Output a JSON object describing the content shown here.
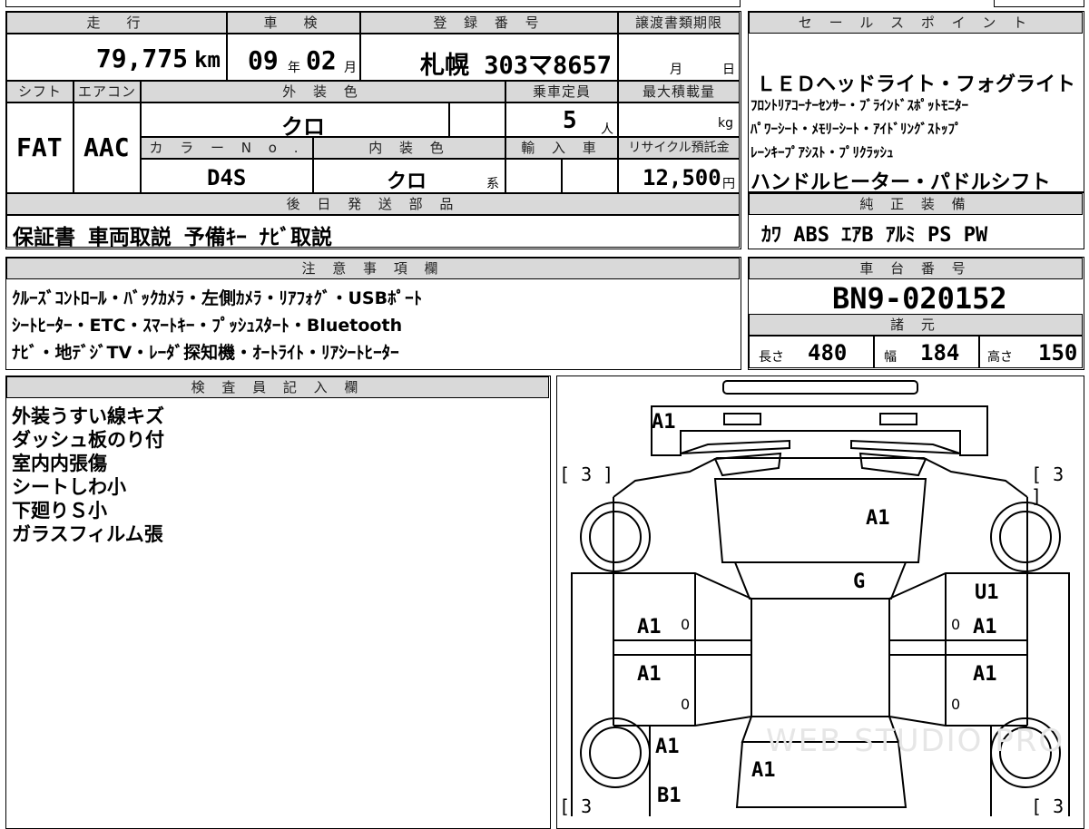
{
  "top": {
    "mileage_label": "走　行",
    "mileage_value": "79,775",
    "mileage_unit": "km",
    "inspection_label": "車　検",
    "inspection_year": "09",
    "inspection_year_unit": "年",
    "inspection_month": "02",
    "inspection_month_unit": "月",
    "plate_label": "登 録 番 号",
    "plate_value": "札幌 303マ8657",
    "transfer_label": "譲渡書類期限",
    "transfer_month": "月",
    "transfer_day": "日",
    "shift_label": "シフト",
    "shift_value": "FAT",
    "ac_label": "エアコン",
    "ac_value": "AAC",
    "exterior_label": "外 装 色",
    "exterior_value": "クロ",
    "capacity_label": "乗車定員",
    "capacity_value": "5",
    "capacity_unit": "人",
    "maxload_label": "最大積載量",
    "maxload_unit": "kg",
    "colorno_label": "カ ラ ー N o .",
    "colorno_value": "D4S",
    "interior_label": "内 装 色",
    "interior_value": "クロ",
    "interior_suffix": "系",
    "import_label": "輸 入 車",
    "recycle_label": "リサイクル預託金",
    "recycle_value": "12,500",
    "recycle_unit": "円",
    "later_label": "後 日 発 送 部 品",
    "later_value": "保証書 車両取説 予備ｷｰ ﾅﾋﾞ取説"
  },
  "sales": {
    "label": "セ ー ル ス ポ イ ン ト",
    "lines": [
      "ＬＥＤヘッドライト・フォグライト",
      "ﾌﾛﾝﾄﾘｱｺｰﾅｰｾﾝｻｰ・ﾌﾞﾗｲﾝﾄﾞｽﾎﾟｯﾄﾓﾆﾀｰ",
      "ﾊﾟﾜｰｼｰﾄ・ﾒﾓﾘｰｼｰﾄ・ｱｲﾄﾞﾘﾝｸﾞｽﾄｯﾌﾟ",
      "ﾚｰﾝｷｰﾌﾟｱｼｽﾄ・ﾌﾟﾘｸﾗｯｼｭ",
      "ハンドルヒーター・パドルシフト"
    ]
  },
  "equipment": {
    "label": "純 正 装 備",
    "value": "ｶﾜ ABS ｴｱB ｱﾙﾐ PS PW"
  },
  "notes": {
    "label": "注 意 事 項 欄",
    "lines": [
      "ｸﾙｰｽﾞｺﾝﾄﾛｰﾙ・ﾊﾞｯｸｶﾒﾗ・左側ｶﾒﾗ・ﾘｱﾌｫｸﾞ・USBﾎﾟｰﾄ",
      "ｼｰﾄﾋｰﾀｰ・ETC・ｽﾏｰﾄｷｰ・ﾌﾟｯｼｭｽﾀｰﾄ・Bluetooth",
      "ﾅﾋﾞ・地ﾃﾞｼﾞTV・ﾚｰﾀﾞ探知機・ｵｰﾄﾗｲﾄ・ﾘｱｼｰﾄﾋｰﾀｰ"
    ]
  },
  "chassis": {
    "label": "車 台 番 号",
    "value": "BN9-020152",
    "spec_label": "諸 元",
    "length_label": "長さ",
    "length_value": "480",
    "width_label": "幅",
    "width_value": "184",
    "height_label": "高さ",
    "height_value": "150"
  },
  "inspector": {
    "label": "検 査 員 記 入 欄",
    "lines": [
      "外装うすい線キズ",
      "ダッシュ板のり付",
      "室内内張傷",
      "シートしわ小",
      "下廻りＳ小",
      "ガラスフィルム張"
    ]
  },
  "diagram": {
    "marks": {
      "front_bumper": "A1",
      "hood": "A1",
      "windshield": "G",
      "right_front_fender": "U1",
      "right_front_door": "A1",
      "right_rear_door": "A1",
      "left_front_door": "A1",
      "left_rear_door": "A1",
      "left_quarter": "A1",
      "trunk": "A1",
      "left_rear_bumper": "B1",
      "tire_fl": "[ 3 ]",
      "tire_fr": "[ 3 ]",
      "tire_rl": "[ 3",
      "tire_rr": "[ 3"
    },
    "zeros": [
      "0",
      "0",
      "0",
      "0"
    ],
    "watermark": "WEB STUDIO PRO"
  }
}
